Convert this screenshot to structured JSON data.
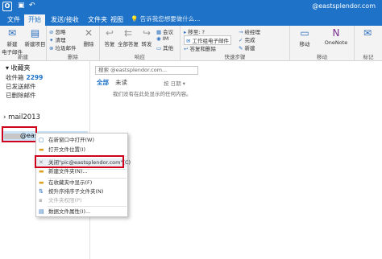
{
  "titlebar": {
    "app_icon": "outlook-icon",
    "save_icon": "save-icon",
    "undo_icon": "undo-icon",
    "user": "@eastsplendor.com"
  },
  "ribbon_tabs": [
    {
      "label": "文件"
    },
    {
      "label": "开始"
    },
    {
      "label": "发送/接收"
    },
    {
      "label": "文件夹"
    },
    {
      "label": "视图"
    }
  ],
  "tell_me": "告诉我您想要做什么...",
  "ribbon": {
    "new_group": {
      "label": "新建",
      "new_email": "新建\n电子邮件",
      "new_items": "新建项目"
    },
    "delete_group": {
      "label": "删除",
      "ignore": "忽略",
      "cleanup": "清理",
      "junk": "垃圾邮件",
      "delete": "删除"
    },
    "respond_group": {
      "label": "响应",
      "reply": "答复",
      "reply_all": "全部答复",
      "forward": "转发",
      "meeting": "会议",
      "im": "IM",
      "more": "其他"
    },
    "quicksteps_group": {
      "label": "快速步骤",
      "move_to": "移至: ?",
      "to_manager": "给经理",
      "team_email": "工作组电子邮件",
      "done": "完成",
      "reply_delete": "答复和删除",
      "create_new": "新建"
    },
    "move_group": {
      "label": "移动",
      "move": "移动",
      "onenote": "OneNote"
    },
    "tags_group": {
      "label": "标记"
    }
  },
  "folders": {
    "favorites": "收藏夹",
    "inbox": "收件箱",
    "inbox_count": "2299",
    "sent": "已发送邮件",
    "deleted": "已删除邮件",
    "mail2013": "mail2013",
    "account": "@eastsplendor.com"
  },
  "mail_list": {
    "search_placeholder": "搜索 @eastsplendor.com...",
    "filter_all": "全部",
    "filter_unread": "未读",
    "sort": "按 日期 ▾",
    "empty_msg": "我们没有在此处显示的任何内容。"
  },
  "context_menu": [
    {
      "label": "在新窗口中打开(W)",
      "icon": "new-window-icon"
    },
    {
      "label": "打开文件位置(I)",
      "icon": "folder-icon"
    },
    {
      "label": "关闭\"pic@eastsplendor.com\"(C)",
      "icon": "close-icon"
    },
    {
      "label": "新建文件夹(N)...",
      "icon": "new-folder-icon"
    },
    {
      "label": "在收藏夹中显示(F)",
      "icon": "star-icon"
    },
    {
      "label": "按升序排序子文件夹(N)",
      "icon": "sort-icon"
    },
    {
      "label": "文件夹权限(P)",
      "icon": "permissions-icon"
    },
    {
      "label": "数据文件属性(I)...",
      "icon": "properties-icon"
    }
  ],
  "colors": {
    "accent": "#1e73c8",
    "highlight": "#cde4f7",
    "callout": "#d0021b"
  }
}
